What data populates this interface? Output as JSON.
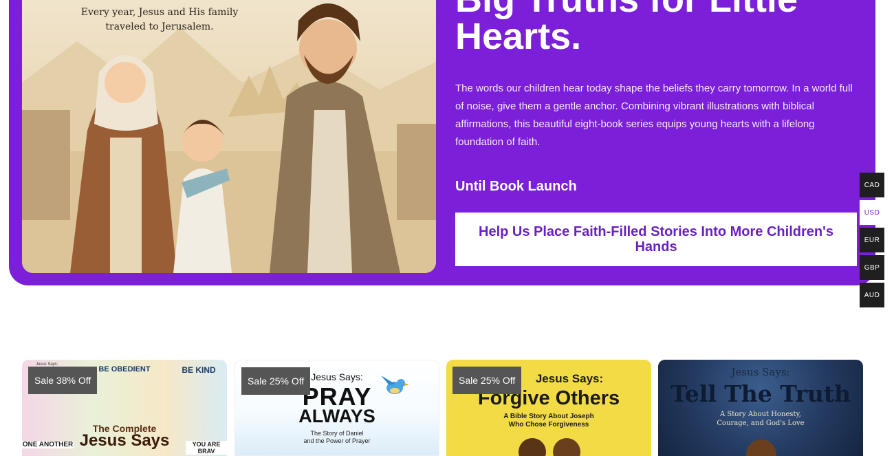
{
  "hero": {
    "image_caption_line1": "Every year, Jesus and His family",
    "image_caption_line2": "traveled to Jerusalem.",
    "title_line1": "Big Truths for Little",
    "title_line2": "Hearts.",
    "description": "The words our children hear today shape the beliefs they carry tomorrow. In a world full of noise, give them a gentle anchor. Combining vibrant illustrations with biblical affirmations, this beautiful eight-book series equips young hearts with a lifelong foundation of faith.",
    "launch_label": "Until Book Launch",
    "cta_label": "Help Us Place Faith-Filled Stories Into More Children's Hands"
  },
  "currency_switcher": {
    "options": [
      "CAD",
      "USD",
      "EUR",
      "GBP",
      "AUD"
    ],
    "selected": "USD"
  },
  "products": [
    {
      "badge": "Sale 38% Off",
      "cover_labels": [
        "Jesus Says:",
        "BE OBEDIENT",
        "BE KIND",
        "The Complete",
        "Jesus Says",
        "ONE ANOTHER",
        "YOU ARE BRAV"
      ]
    },
    {
      "badge": "Sale 25% Off",
      "cover_labels": [
        "Jesus Says:",
        "PRAY",
        "ALWAYS",
        "The Story of Daniel",
        "and the Power of Prayer"
      ]
    },
    {
      "badge": "Sale 25% Off",
      "cover_labels": [
        "Jesus Says:",
        "Forgive Others",
        "A Bible Story About Joseph",
        "Who Chose Forgiveness"
      ]
    },
    {
      "badge": "",
      "cover_labels": [
        "Jesus Says:",
        "Tell The Truth",
        "A Story About Honesty,",
        "Courage, and God's Love"
      ]
    }
  ],
  "colors": {
    "hero_bg": "#7b1fd8",
    "cta_text": "#6a1fc2",
    "currency_bg": "#1f1f1f",
    "badge_bg": "#555555"
  }
}
